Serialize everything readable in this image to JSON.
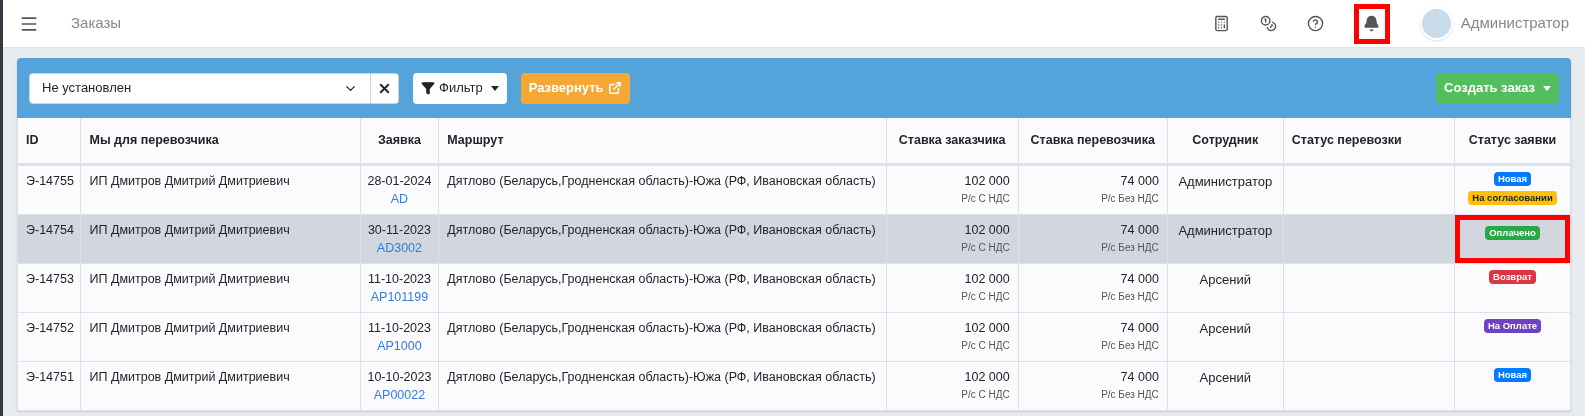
{
  "header": {
    "title": "Заказы",
    "notifications": {
      "highlighted": true
    },
    "user": {
      "name": "Администратор"
    }
  },
  "toolbar": {
    "select": {
      "value": "Не установлен"
    },
    "filter_button": "Фильтр",
    "expand_button": "Развернуть",
    "create_button": "Создать заказ"
  },
  "table": {
    "columns": [
      "ID",
      "Мы для перевозчика",
      "Заявка",
      "Маршрут",
      "Ставка заказчика",
      "Ставка перевозчика",
      "Сотрудник",
      "Статус перевозки",
      "Статус заявки"
    ],
    "rows": [
      {
        "selected": false,
        "id": "Э-14755",
        "carrier": "ИП Дмитров Дмитрий Дмитриевич",
        "date": "28-01-2024",
        "request": "AD",
        "route": "Дятлово (Беларусь,Гродненская область)-Южа (РФ, Ивановская область)",
        "client_rate": "102 000",
        "client_rate_note": "Р/с С НДС",
        "carrier_rate": "74 000",
        "carrier_rate_note": "Р/с Без НДС",
        "employee": "Администратор",
        "status_highlighted": false,
        "statuses": [
          {
            "label": "Новая",
            "color": "#007bff"
          },
          {
            "label": "На согласовании",
            "color": "#ffc107"
          }
        ]
      },
      {
        "selected": true,
        "id": "Э-14754",
        "carrier": "ИП Дмитров Дмитрий Дмитриевич",
        "date": "30-11-2023",
        "request": "AD3002",
        "route": "Дятлово (Беларусь,Гродненская область)-Южа (РФ, Ивановская область)",
        "client_rate": "102 000",
        "client_rate_note": "Р/с С НДС",
        "carrier_rate": "74 000",
        "carrier_rate_note": "Р/с Без НДС",
        "employee": "Администратор",
        "status_highlighted": true,
        "statuses": [
          {
            "label": "Оплачено",
            "color": "#28a745"
          }
        ]
      },
      {
        "selected": false,
        "id": "Э-14753",
        "carrier": "ИП Дмитров Дмитрий Дмитриевич",
        "date": "11-10-2023",
        "request": "AP101199",
        "route": "Дятлово (Беларусь,Гродненская область)-Южа (РФ, Ивановская область)",
        "client_rate": "102 000",
        "client_rate_note": "Р/с С НДС",
        "carrier_rate": "74 000",
        "carrier_rate_note": "Р/с Без НДС",
        "employee": "Арсений",
        "status_highlighted": false,
        "statuses": [
          {
            "label": "Возврат",
            "color": "#dc3545"
          }
        ]
      },
      {
        "selected": false,
        "id": "Э-14752",
        "carrier": "ИП Дмитров Дмитрий Дмитриевич",
        "date": "11-10-2023",
        "request": "AP1000",
        "route": "Дятлово (Беларусь,Гродненская область)-Южа (РФ, Ивановская область)",
        "client_rate": "102 000",
        "client_rate_note": "Р/с С НДС",
        "carrier_rate": "74 000",
        "carrier_rate_note": "Р/с Без НДС",
        "employee": "Арсений",
        "status_highlighted": false,
        "statuses": [
          {
            "label": "На Оплате",
            "color": "#6f42c1"
          }
        ]
      },
      {
        "selected": false,
        "id": "Э-14751",
        "carrier": "ИП Дмитров Дмитрий Дмитриевич",
        "date": "10-10-2023",
        "request": "AP00022",
        "route": "Дятлово (Беларусь,Гродненская область)-Южа (РФ, Ивановская область)",
        "client_rate": "102 000",
        "client_rate_note": "Р/с С НДС",
        "carrier_rate": "74 000",
        "carrier_rate_note": "Р/с Без НДС",
        "employee": "Арсений",
        "status_highlighted": false,
        "statuses": [
          {
            "label": "Новая",
            "color": "#007bff"
          }
        ]
      }
    ]
  }
}
